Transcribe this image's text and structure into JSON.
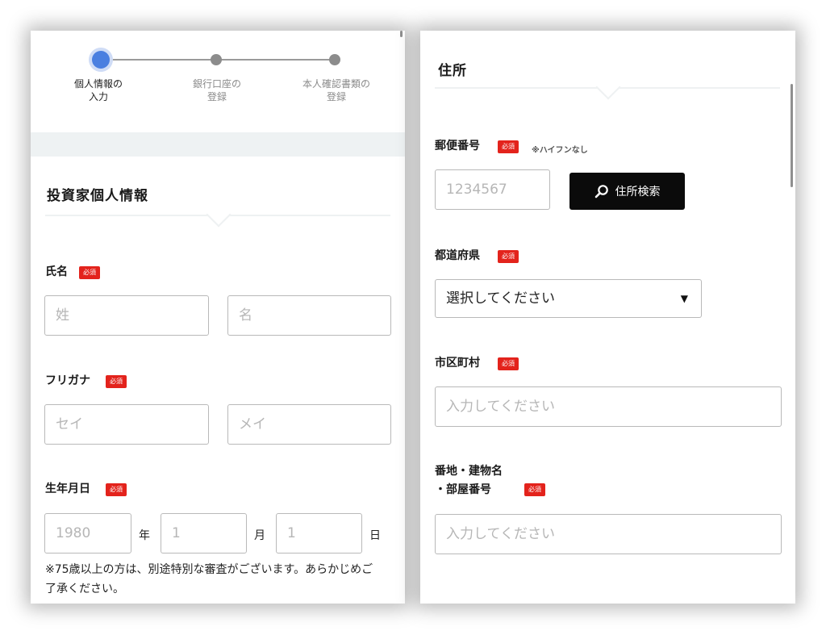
{
  "stepper": {
    "steps": [
      {
        "label": "個人情報の\n入力",
        "state": "active"
      },
      {
        "label": "銀行口座の\n登録",
        "state": "inactive"
      },
      {
        "label": "本人確認書類の\n登録",
        "state": "inactive"
      }
    ]
  },
  "left": {
    "section_title": "投資家個人情報",
    "name": {
      "label": "氏名",
      "required": "必須",
      "last_placeholder": "姓",
      "first_placeholder": "名"
    },
    "kana": {
      "label": "フリガナ",
      "required": "必須",
      "last_placeholder": "セイ",
      "first_placeholder": "メイ"
    },
    "birth": {
      "label": "生年月日",
      "required": "必須",
      "year_placeholder": "1980",
      "year_unit": "年",
      "month_placeholder": "1",
      "month_unit": "月",
      "day_placeholder": "1",
      "day_unit": "日",
      "note": "※75歳以上の方は、別途特別な審査がございます。あらかじめご了承ください。"
    }
  },
  "right": {
    "section_title": "住所",
    "postal": {
      "label": "郵便番号",
      "required": "必須",
      "hint": "※ハイフンなし",
      "placeholder": "1234567",
      "search_button": "住所検索"
    },
    "prefecture": {
      "label": "都道府県",
      "required": "必須",
      "selected": "選択してください"
    },
    "city": {
      "label": "市区町村",
      "required": "必須",
      "placeholder": "入力してください"
    },
    "address": {
      "label_line1": "番地・建物名",
      "label_line2": "・部屋番号",
      "required": "必須",
      "placeholder": "入力してください"
    }
  },
  "icons": {
    "search": "search-icon",
    "dropdown": "triangle-down-icon"
  },
  "colors": {
    "accent": "#4a7fe0",
    "required_badge": "#e3231c",
    "button_bg": "#0b0b0b"
  }
}
